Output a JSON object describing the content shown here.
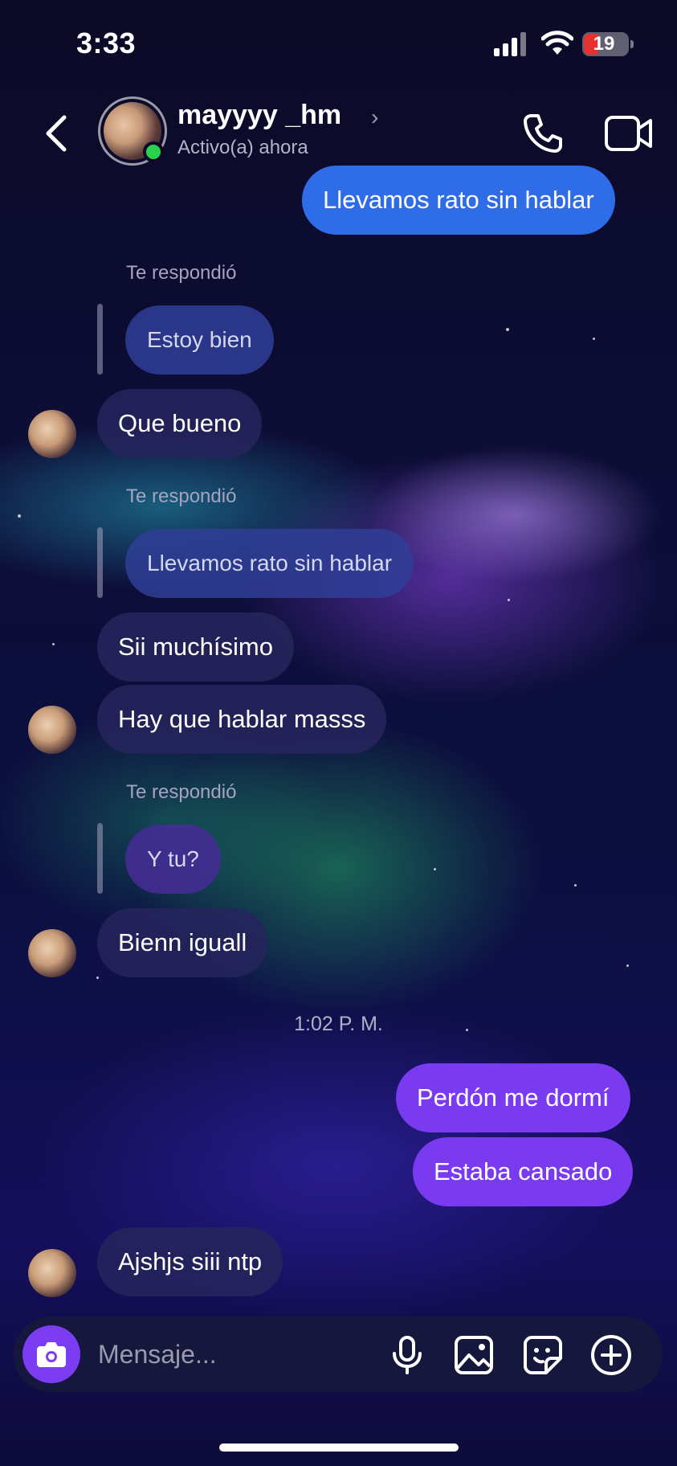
{
  "status_bar": {
    "time": "3:33",
    "battery": "19"
  },
  "header": {
    "contact_name": "mayyyy _hm",
    "contact_status": "Activo(a) ahora",
    "icons": [
      "back-chevron-icon",
      "phone-icon",
      "video-camera-icon"
    ]
  },
  "messages": {
    "m1": "Llevamos rato sin hablar",
    "r1_label": "Te respondió",
    "r1_quote": "Estoy bien",
    "m2": "Que bueno",
    "r2_label": "Te respondió",
    "r2_quote": "Llevamos rato sin hablar",
    "m3": "Sii muchísimo",
    "m4": "Hay que hablar masss",
    "r3_label": "Te respondió",
    "r3_quote": "Y tu?",
    "m5": "Bienn iguall",
    "timestamp": "1:02 P. M.",
    "m6": "Perdón me dormí",
    "m7": "Estaba cansado",
    "m8": "Ajshjs siii ntp"
  },
  "composer": {
    "placeholder": "Mensaje...",
    "icons": [
      "camera-icon",
      "microphone-icon",
      "gallery-icon",
      "sticker-icon",
      "plus-icon"
    ]
  },
  "colors": {
    "outgoing_blue": "#2f6de8",
    "outgoing_purple": "#7a3af0",
    "incoming": "#26245c",
    "online": "#2bd14a"
  }
}
